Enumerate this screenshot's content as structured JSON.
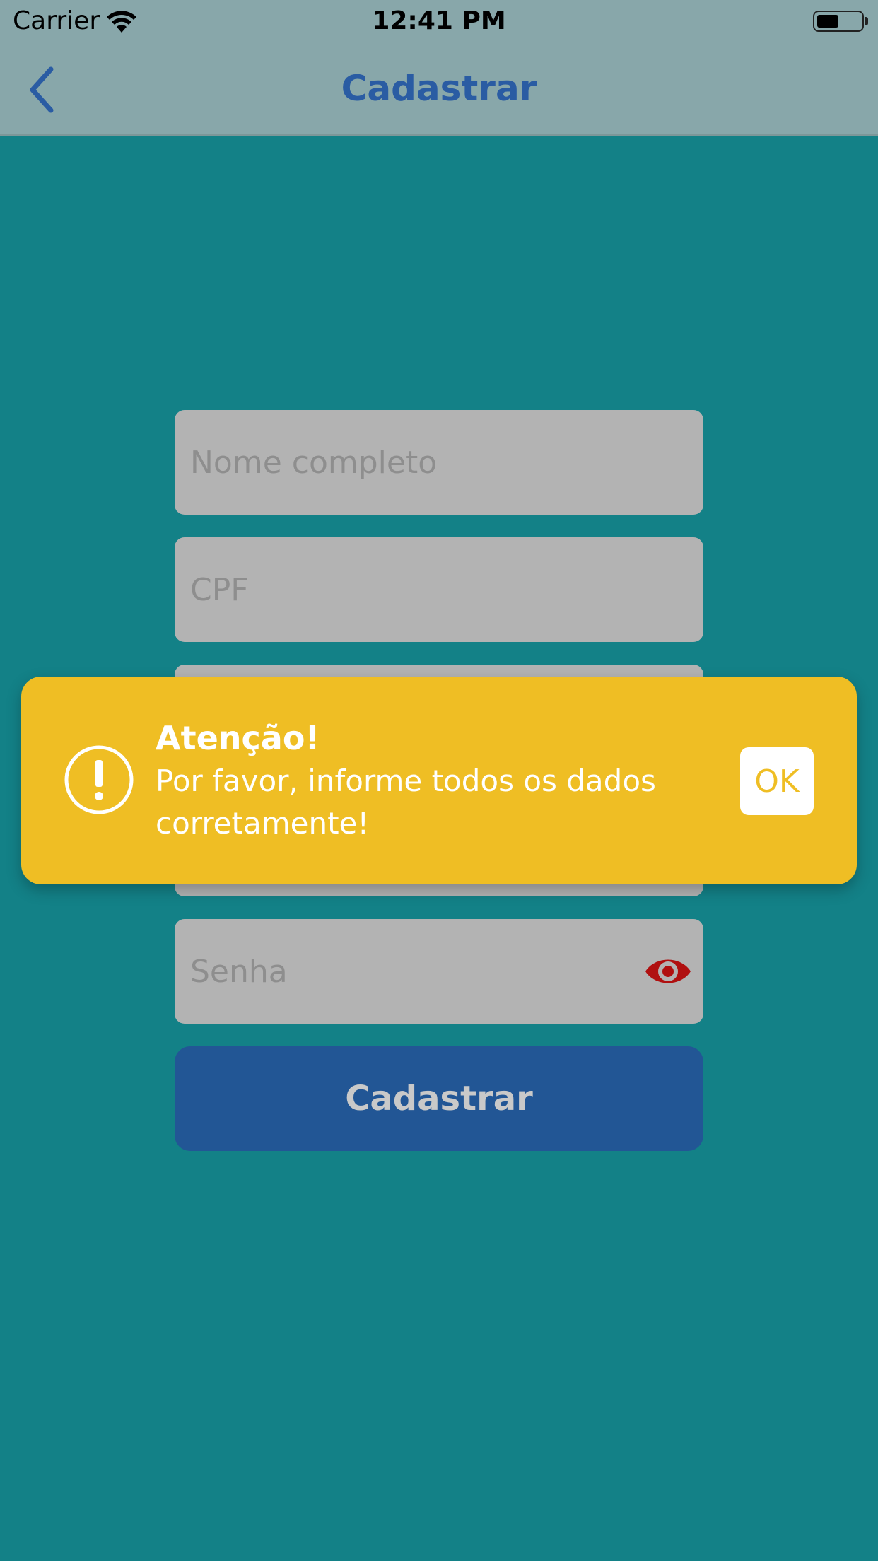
{
  "status_bar": {
    "carrier": "Carrier",
    "time": "12:41 PM",
    "icons": [
      "wifi-icon",
      "battery-icon"
    ]
  },
  "navbar": {
    "back_icon": "chevron-left-icon",
    "title": "Cadastrar",
    "accent_color": "#2a5ca3"
  },
  "form": {
    "fields": [
      {
        "placeholder": "Nome completo",
        "value": ""
      },
      {
        "placeholder": "CPF",
        "value": ""
      },
      {
        "placeholder": "Senha",
        "value": "",
        "trailing_icon": "eye-icon"
      }
    ],
    "submit_label": "Cadastrar",
    "submit_color": "#225695"
  },
  "alert": {
    "icon": "exclamation-circle-icon",
    "title": "Atenção!",
    "message": "Por favor, informe todos os dados corretamente!",
    "ok_label": "OK",
    "background_color": "#efbe24"
  },
  "colors": {
    "background": "#138187",
    "bar_background": "#88a7aa",
    "field_background": "#b3b3b3",
    "eye_icon_color": "#b01010"
  }
}
